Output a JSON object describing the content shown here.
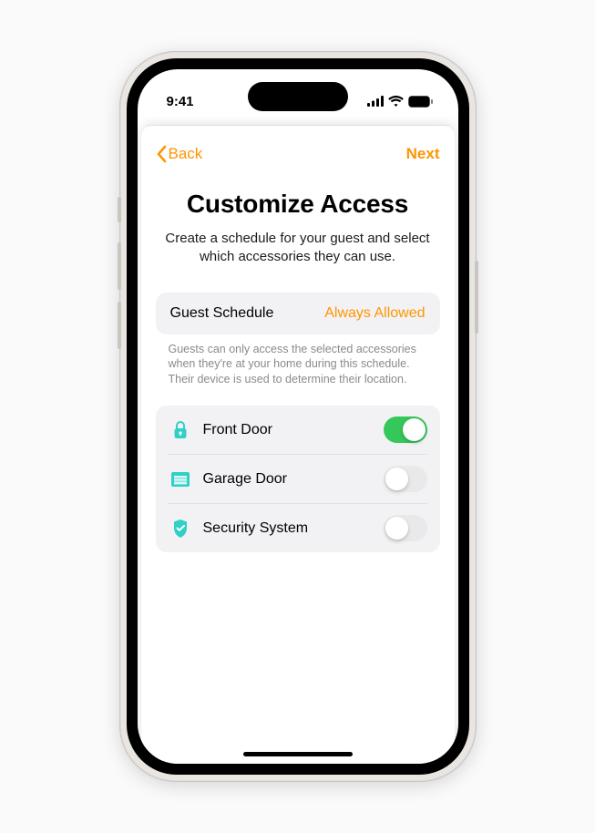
{
  "status_bar": {
    "time": "9:41"
  },
  "nav": {
    "back": "Back",
    "next": "Next"
  },
  "page": {
    "title": "Customize Access",
    "subtitle": "Create a schedule for your guest and select which accessories they can use."
  },
  "schedule": {
    "label": "Guest Schedule",
    "value": "Always Allowed",
    "footer": "Guests can only access the selected accessories when they're at your home during this schedule. Their device is used to determine their location."
  },
  "accessories": [
    {
      "icon": "lock",
      "name": "Front Door",
      "enabled": true
    },
    {
      "icon": "garage",
      "name": "Garage Door",
      "enabled": false
    },
    {
      "icon": "shield",
      "name": "Security System",
      "enabled": false
    }
  ],
  "colors": {
    "accent": "#ff9500",
    "teal": "#30d0c6",
    "switch_on": "#34c759"
  }
}
